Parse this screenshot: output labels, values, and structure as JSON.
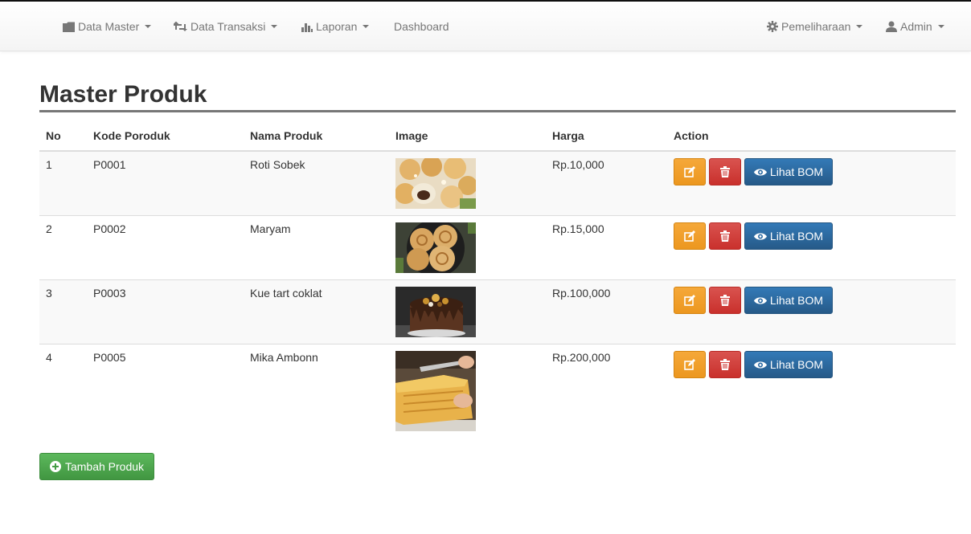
{
  "navbar": {
    "items": [
      {
        "label": "Data Master",
        "icon": "folder-icon",
        "dropdown": true
      },
      {
        "label": "Data Transaksi",
        "icon": "retweet-icon",
        "dropdown": true
      },
      {
        "label": "Laporan",
        "icon": "stats-icon",
        "dropdown": true
      },
      {
        "label": "Dashboard",
        "icon": "",
        "dropdown": false
      }
    ],
    "right_items": [
      {
        "label": "Pemeliharaan",
        "icon": "cog-icon",
        "dropdown": true
      },
      {
        "label": "Admin",
        "icon": "user-icon",
        "dropdown": true
      }
    ]
  },
  "page": {
    "title": "Master Produk"
  },
  "table": {
    "headers": {
      "no": "No",
      "kode": "Kode Poroduk",
      "nama": "Nama Produk",
      "image": "Image",
      "harga": "Harga",
      "action": "Action"
    },
    "rows": [
      {
        "no": "1",
        "kode": "P0001",
        "nama": "Roti Sobek",
        "harga": "Rp.10,000",
        "image": "roti-sobek-photo"
      },
      {
        "no": "2",
        "kode": "P0002",
        "nama": "Maryam",
        "harga": "Rp.15,000",
        "image": "maryam-photo"
      },
      {
        "no": "3",
        "kode": "P0003",
        "nama": "Kue tart coklat",
        "harga": "Rp.100,000",
        "image": "kue-tart-coklat-photo"
      },
      {
        "no": "4",
        "kode": "P0005",
        "nama": "Mika Ambonn",
        "harga": "Rp.200,000",
        "image": "mika-ambonn-photo"
      }
    ],
    "action_labels": {
      "edit_icon": "edit-icon",
      "delete_icon": "trash-icon",
      "bom": "Lihat BOM"
    }
  },
  "add_button": {
    "label": "Tambah Produk",
    "icon": "plus-circle-icon"
  },
  "colors": {
    "edit": "#ec971f",
    "delete": "#c9302c",
    "bom": "#2b6aa3",
    "add": "#4cae4c"
  }
}
